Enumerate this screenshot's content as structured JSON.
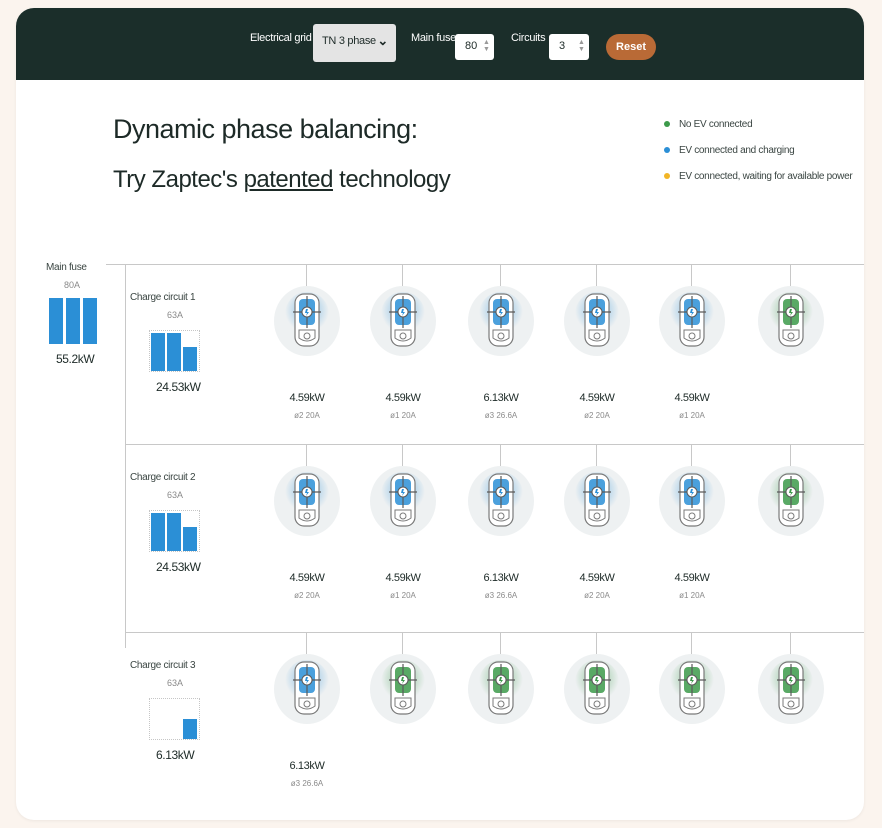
{
  "toolbar": {
    "grid_label": "Electrical grid",
    "grid_value": "TN 3 phase",
    "fuse_label": "Main fuse",
    "fuse_value": "80",
    "circuits_label": "Circuits",
    "circuits_value": "3",
    "reset_label": "Reset"
  },
  "heading": {
    "line1": "Dynamic phase balancing:",
    "line2_pre": "Try Zaptec's ",
    "line2_link": "patented",
    "line2_post": " technology"
  },
  "legend": [
    {
      "label": "No EV connected",
      "color": "#3c9a4a"
    },
    {
      "label": "EV connected and charging",
      "color": "#2b8fd6"
    },
    {
      "label": "EV connected, waiting for available power",
      "color": "#f2b526"
    }
  ],
  "main_fuse": {
    "label": "Main fuse",
    "amp": "80A",
    "kw": "55.2kW",
    "phase_load": [
      1,
      1,
      1
    ]
  },
  "colors": {
    "charging": "#2b8fd6",
    "idle": "#3c9a4a",
    "waiting": "#f2b526",
    "toolbar": "#1b2e2a",
    "reset": "#b96a36"
  },
  "circuits": [
    {
      "label": "Charge circuit 1",
      "amp": "63A",
      "kw": "24.53kW",
      "phase_load": [
        0.95,
        0.95,
        0.6
      ],
      "chargers": [
        {
          "status": "charging",
          "kw": "4.59kW",
          "amp": "ø2 20A"
        },
        {
          "status": "charging",
          "kw": "4.59kW",
          "amp": "ø1 20A"
        },
        {
          "status": "charging",
          "kw": "6.13kW",
          "amp": "ø3 26.6A"
        },
        {
          "status": "charging",
          "kw": "4.59kW",
          "amp": "ø2 20A"
        },
        {
          "status": "charging",
          "kw": "4.59kW",
          "amp": "ø1 20A"
        },
        {
          "status": "idle",
          "kw": "",
          "amp": ""
        }
      ]
    },
    {
      "label": "Charge circuit 2",
      "amp": "63A",
      "kw": "24.53kW",
      "phase_load": [
        0.95,
        0.95,
        0.6
      ],
      "chargers": [
        {
          "status": "charging",
          "kw": "4.59kW",
          "amp": "ø2 20A"
        },
        {
          "status": "charging",
          "kw": "4.59kW",
          "amp": "ø1 20A"
        },
        {
          "status": "charging",
          "kw": "6.13kW",
          "amp": "ø3 26.6A"
        },
        {
          "status": "charging",
          "kw": "4.59kW",
          "amp": "ø2 20A"
        },
        {
          "status": "charging",
          "kw": "4.59kW",
          "amp": "ø1 20A"
        },
        {
          "status": "idle",
          "kw": "",
          "amp": ""
        }
      ]
    },
    {
      "label": "Charge circuit 3",
      "amp": "63A",
      "kw": "6.13kW",
      "phase_load": [
        0,
        0,
        0.5
      ],
      "chargers": [
        {
          "status": "charging",
          "kw": "6.13kW",
          "amp": "ø3 26.6A"
        },
        {
          "status": "idle",
          "kw": "",
          "amp": ""
        },
        {
          "status": "idle",
          "kw": "",
          "amp": ""
        },
        {
          "status": "idle",
          "kw": "",
          "amp": ""
        },
        {
          "status": "idle",
          "kw": "",
          "amp": ""
        },
        {
          "status": "idle",
          "kw": "",
          "amp": ""
        }
      ]
    }
  ]
}
